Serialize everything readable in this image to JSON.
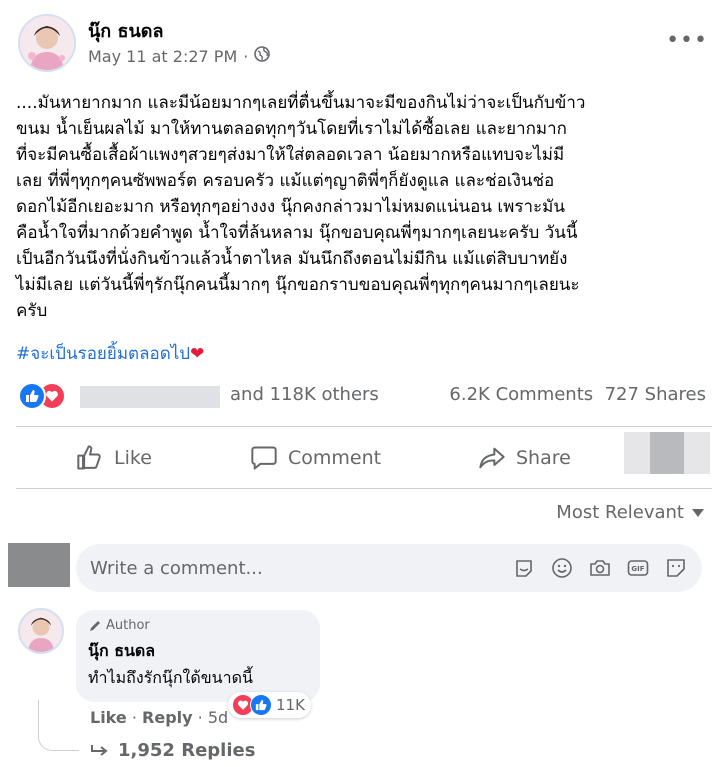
{
  "post": {
    "author": "นุ๊ก ธนดล",
    "timestamp": "May 11 at 2:27 PM",
    "privacy_icon": "globe-icon",
    "body": "....มันหายากมาก และมีน้อยมากๆเลยที่ตื่นขึ้นมาจะมีของกินไม่ว่าจะเป็นกับข้าว\nขนม น้ำเย็นผลไม้ มาให้ทานตลอดทุกๆวันโดยที่เราไม่ได้ซื้อเลย และยากมาก\nที่จะมีคนซื้อเสื้อผ้าแพงๆสวยๆส่งมาให้ใส่ตลอดเวลา น้อยมากหรือแทบจะไม่มี\nเลย ที่พี่ๆทุกๆคนซัพพอร์ต ครอบครัว แม้แต่ๆญาติพี่ๆก็ยังดูแล และช่อเงินช่อ\nดอกไม้อีกเยอะมาก หรือทุกๆอย่างงง นุ๊กคงกล่าวมาไม่หมดแน่นอน เพราะมัน\nคือน้ำใจที่มากด้วยคำพูด น้ำใจที่ล้นหลาม นุ๊กขอบคุณพี่ๆมากๆเลยนะครับ วันนี้\nเป็นอีกวันนึงที่นั่งกินข้าวแล้วน้ำตาไหล มันนึกถึงตอนไม่มีกิน แม้แต่สิบบาทยัง\nไม่มีเลย แต่วันนี้พี่ๆรักนุ๊กคนนี้มากๆ นุ๊กขอกราบขอบคุณพี่ๆทุกๆคนมากๆเลยนะ\nครับ",
    "hashtag": "#จะเป็นรอยยิ้มตลอดไป",
    "hashtag_emoji": "❤"
  },
  "reactions": {
    "others": "and 118K others",
    "comments": "6.2K Comments",
    "shares": "727 Shares"
  },
  "actions": {
    "like": "Like",
    "comment": "Comment",
    "share": "Share"
  },
  "sort": {
    "label": "Most Relevant"
  },
  "comment_input": {
    "placeholder": "Write a comment..."
  },
  "reply": {
    "badge": "Author",
    "name": "นุ๊ก ธนดล",
    "text": "ทำไมถึงรักนุ๊กใด้ขนาดนี้",
    "reaction_count": "11K",
    "like": "Like",
    "reply": "Reply",
    "age": "5d",
    "replies_link": "1,952 Replies"
  },
  "colors": {
    "like_blue": "#1877f2",
    "love_red": "#f33e58",
    "hashtag": "#216fdb",
    "secondary_text": "#65676b"
  }
}
